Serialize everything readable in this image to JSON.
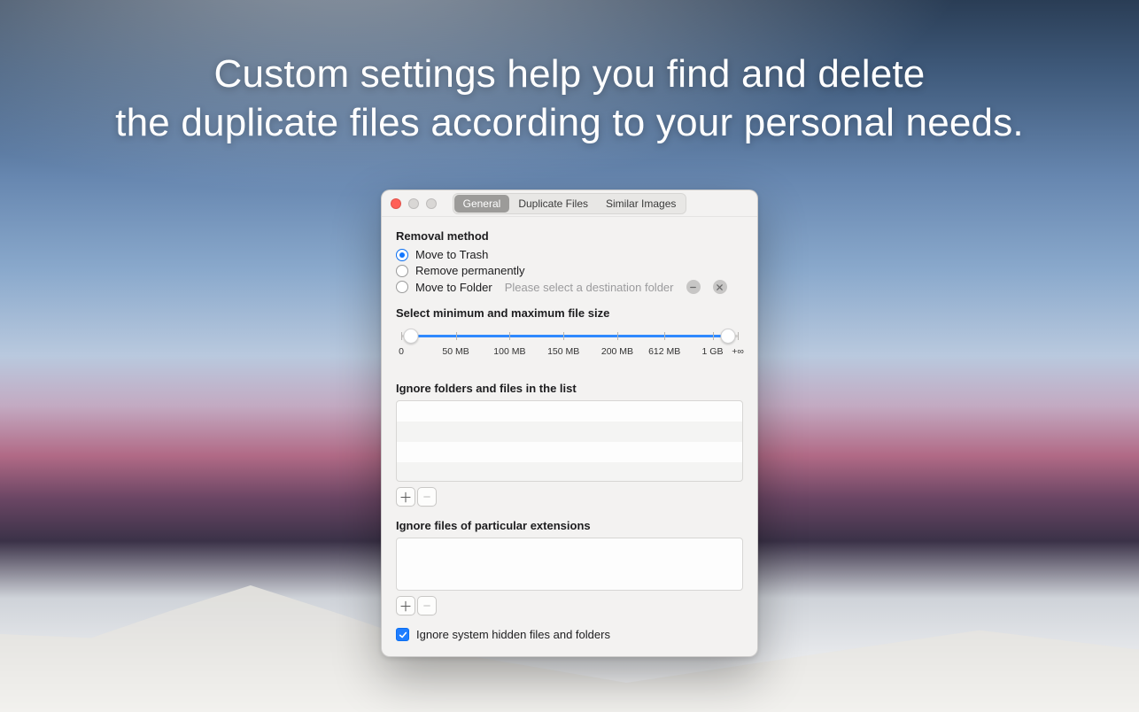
{
  "headline": {
    "line1": "Custom settings help you find and delete",
    "line2": "the duplicate files according to your personal needs."
  },
  "tabs": {
    "general": "General",
    "duplicate": "Duplicate Files",
    "similar": "Similar Images"
  },
  "removal": {
    "title": "Removal method",
    "trash": "Move to Trash",
    "permanent": "Remove permanently",
    "folder": "Move to Folder",
    "folder_placeholder": "Please select a destination folder",
    "selected": "trash"
  },
  "size": {
    "title": "Select minimum and maximum file size",
    "ticks": [
      "0",
      "50 MB",
      "100 MB",
      "150 MB",
      "200 MB",
      "612 MB",
      "1 GB",
      "+∞"
    ]
  },
  "ignore_folders_title": "Ignore folders and files in the list",
  "ignore_ext_title": "Ignore files of particular extensions",
  "hidden_label": "Ignore system hidden files and folders",
  "glyph": {
    "plus": "＋",
    "minus": "−"
  }
}
